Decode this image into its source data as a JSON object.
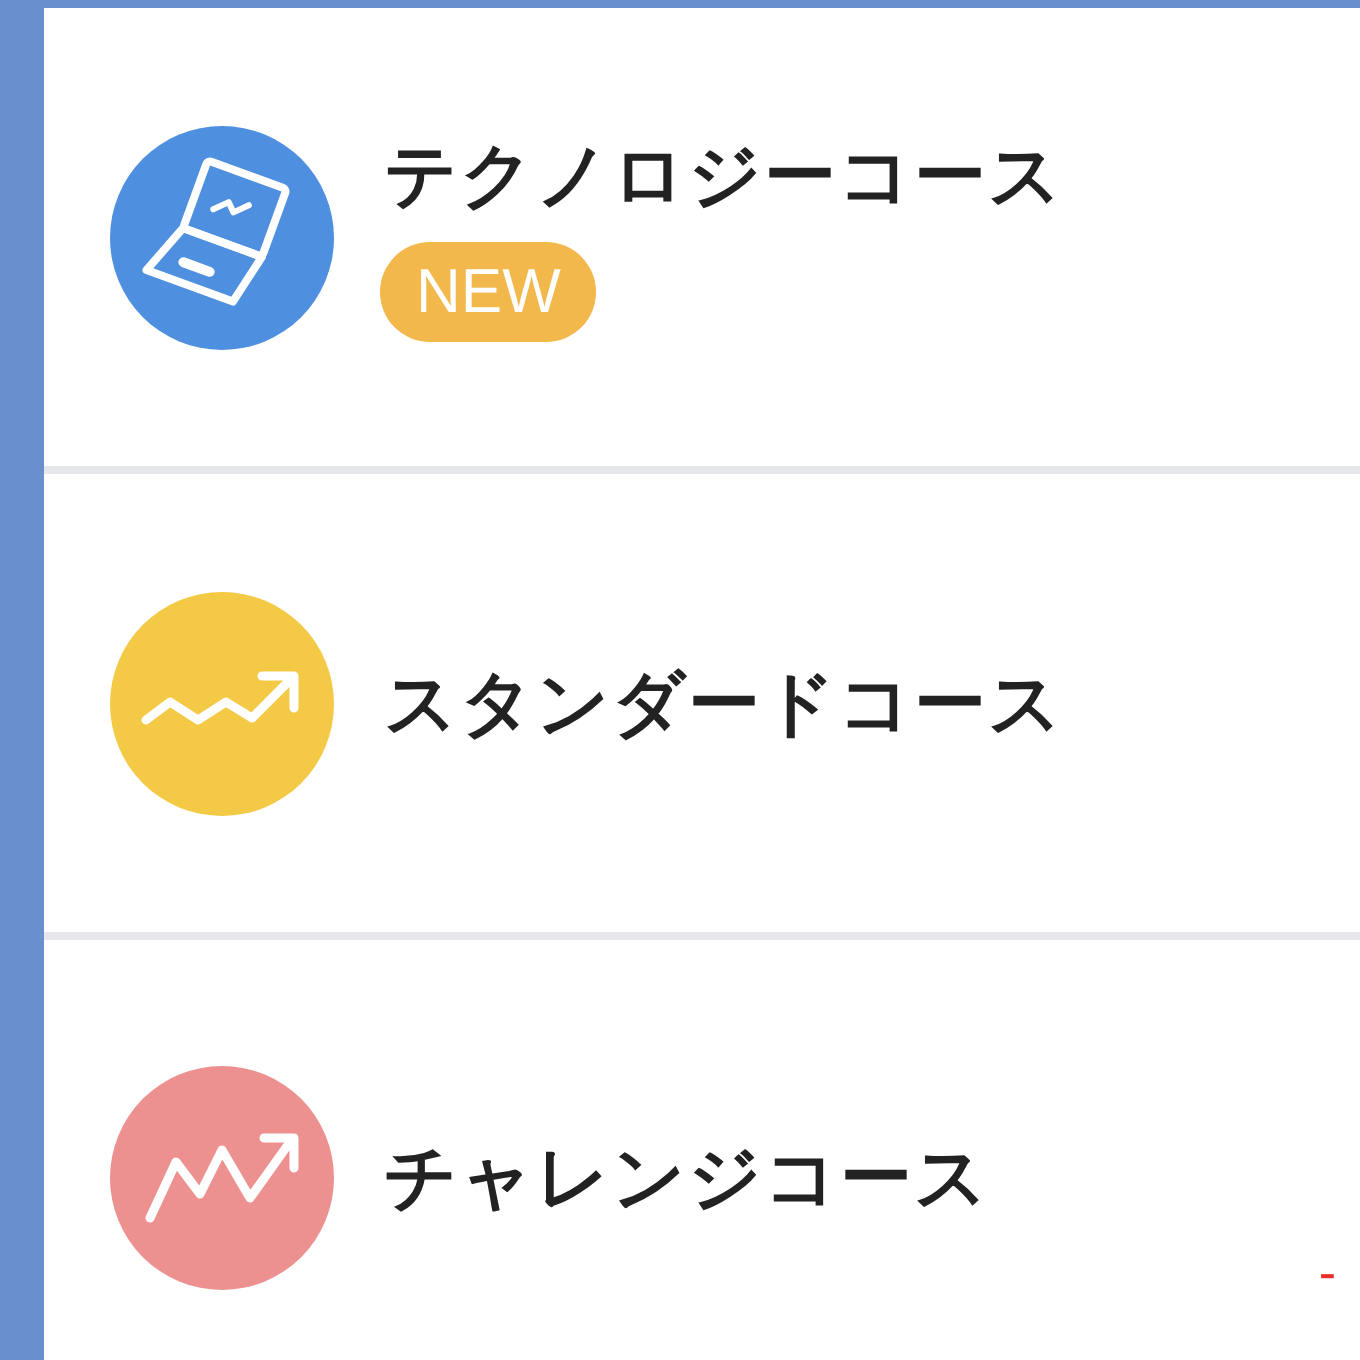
{
  "courses": [
    {
      "kind": "laptop",
      "title": "テクノロジーコース",
      "color": "#4f8fdf",
      "badge": "NEW"
    },
    {
      "kind": "wave",
      "title": "スタンダードコース",
      "color": "#f4c945"
    },
    {
      "kind": "zigzag",
      "title": "チャレンジコース",
      "color": "#ec918f"
    }
  ],
  "corner_text": "-"
}
